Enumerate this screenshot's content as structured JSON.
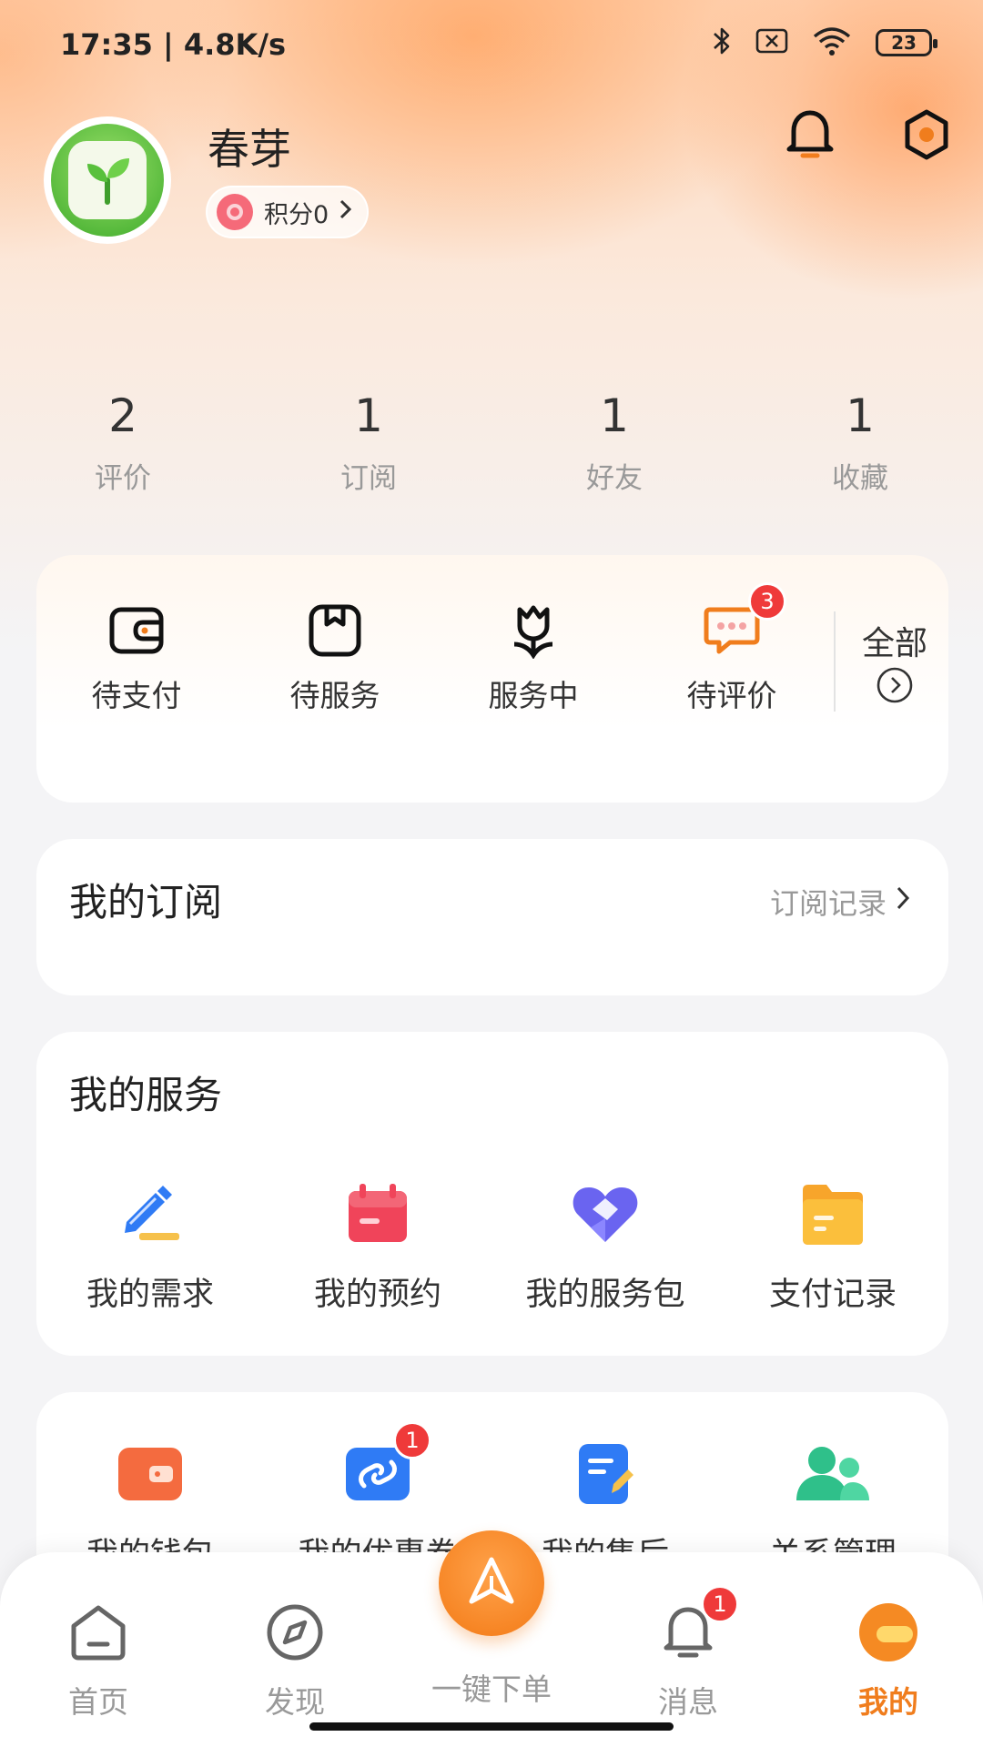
{
  "status_bar": {
    "time_speed": "17:35 | 4.8K/s",
    "battery": "23"
  },
  "profile": {
    "name": "春芽",
    "points": "积分0"
  },
  "stats": [
    {
      "value": "2",
      "label": "评价"
    },
    {
      "value": "1",
      "label": "订阅"
    },
    {
      "value": "1",
      "label": "好友"
    },
    {
      "value": "1",
      "label": "收藏"
    }
  ],
  "orders": {
    "items": [
      {
        "label": "待支付",
        "icon": "wallet-icon"
      },
      {
        "label": "待服务",
        "icon": "box-icon"
      },
      {
        "label": "服务中",
        "icon": "flower-icon"
      },
      {
        "label": "待评价",
        "icon": "chat-icon",
        "badge": "3"
      }
    ],
    "all_label": "全部"
  },
  "subscription": {
    "title": "我的订阅",
    "link": "订阅记录"
  },
  "services": {
    "title": "我的服务",
    "items": [
      {
        "label": "我的需求",
        "icon": "pen-icon"
      },
      {
        "label": "我的预约",
        "icon": "calendar-icon"
      },
      {
        "label": "我的服务包",
        "icon": "heart-icon"
      },
      {
        "label": "支付记录",
        "icon": "folder-icon"
      }
    ]
  },
  "tools": {
    "items": [
      {
        "label": "我的钱包",
        "icon": "wallet-icon"
      },
      {
        "label": "我的优惠券",
        "icon": "coupon-icon",
        "badge": "1"
      },
      {
        "label": "我的售后",
        "icon": "document-icon"
      },
      {
        "label": "关系管理",
        "icon": "people-icon"
      }
    ]
  },
  "tabbar": {
    "tabs": [
      {
        "label": "首页",
        "icon": "home-icon"
      },
      {
        "label": "发现",
        "icon": "compass-icon"
      },
      {
        "label": "一键下单",
        "icon": "quick-order-icon"
      },
      {
        "label": "消息",
        "icon": "bell-icon",
        "badge": "1"
      },
      {
        "label": "我的",
        "icon": "profile-icon"
      }
    ],
    "active": "我的"
  },
  "colors": {
    "accent": "#f07d1d",
    "badge": "#ef3a3a"
  }
}
